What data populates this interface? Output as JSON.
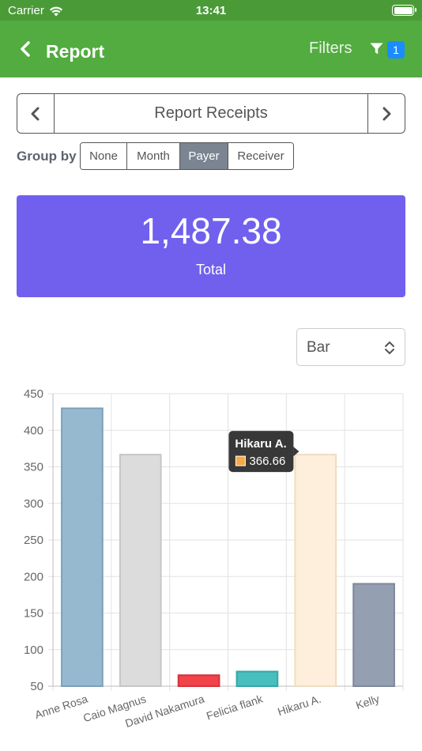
{
  "status_bar": {
    "carrier": "Carrier",
    "time": "13:41"
  },
  "nav": {
    "title": "Report",
    "filters_label": "Filters",
    "filter_count": "1"
  },
  "pager": {
    "title": "Report Receipts"
  },
  "group_by": {
    "label": "Group by",
    "options": [
      "None",
      "Month",
      "Payer",
      "Receiver"
    ],
    "selected": "Payer"
  },
  "total": {
    "value": "1,487.38",
    "label": "Total"
  },
  "chart_select": {
    "value": "Bar"
  },
  "colors": {
    "status_bar": "#4a9b38",
    "nav_bar": "#52ac3f",
    "total_card": "#7160ee",
    "badge": "#1a8cff"
  },
  "chart_data": {
    "type": "bar",
    "categories": [
      "Anne Rosa",
      "Caio Magnus",
      "David Nakamura",
      "Felicia flank",
      "Hikaru A.",
      "Kelly"
    ],
    "values": [
      430,
      366.66,
      65,
      70,
      366.66,
      190
    ],
    "colors": [
      "#97b9d0",
      "#dcdcdc",
      "#f2434b",
      "#48bfbf",
      "#fdefdc",
      "#94a0b2"
    ],
    "borders": [
      "#7aa1bb",
      "#c6c6c6",
      "#d8313a",
      "#36a6a6",
      "#f0dcc0",
      "#7d889a"
    ],
    "ylim": [
      50,
      450
    ],
    "yticks": [
      50,
      100,
      150,
      200,
      250,
      300,
      350,
      400,
      450
    ],
    "grid": true,
    "tooltip": {
      "title": "Hikaru A.",
      "value": "366.66",
      "swatch": "#f7a84a"
    }
  }
}
